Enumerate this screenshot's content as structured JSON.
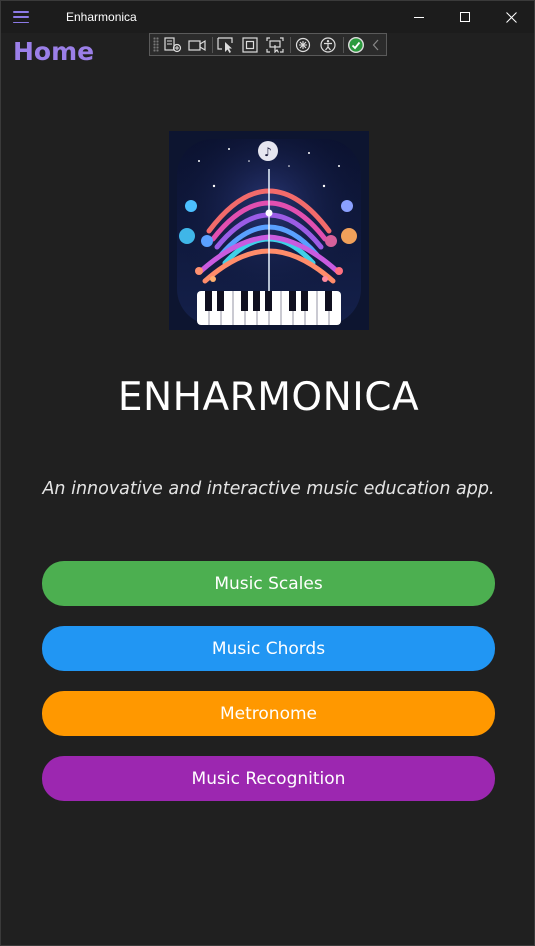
{
  "window": {
    "title": "Enharmonica",
    "controls": [
      "minimize",
      "maximize",
      "close"
    ]
  },
  "debug_toolbar": {
    "icons": [
      "live-visual-tree-icon",
      "record-icon",
      "select-element-icon",
      "display-layout-adorners-icon",
      "track-focus-icon",
      "hot-reload-icon",
      "accessibility-icon",
      "binding-ok-icon",
      "collapse-icon"
    ]
  },
  "header": {
    "title": "Home",
    "accent_color": "#9b7fe8"
  },
  "hero": {
    "logo_icon": "music-logo-icon",
    "app_name": "ENHARMONICA",
    "tagline": "An innovative and interactive music education app."
  },
  "menu": {
    "buttons": [
      {
        "label": "Music Scales",
        "color": "#4caf50"
      },
      {
        "label": "Music Chords",
        "color": "#2196f3"
      },
      {
        "label": "Metronome",
        "color": "#ff9800"
      },
      {
        "label": "Music Recognition",
        "color": "#9c27b0"
      }
    ]
  }
}
